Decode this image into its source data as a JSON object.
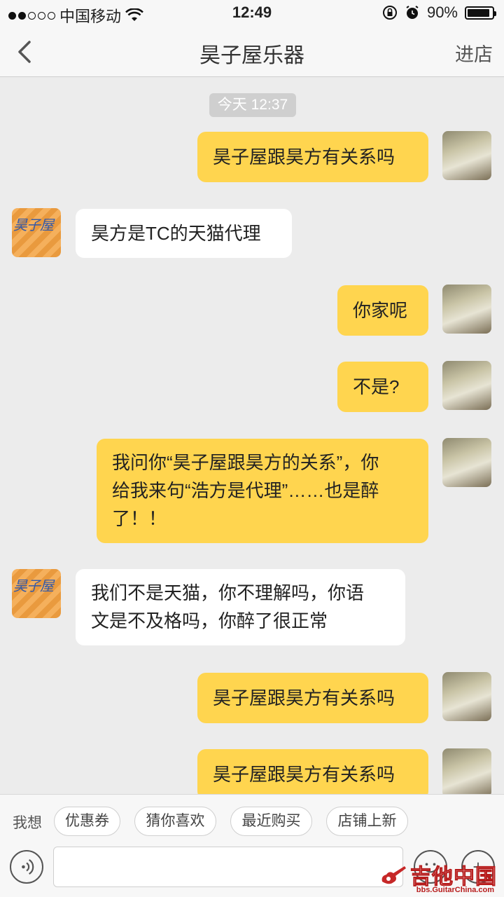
{
  "status_bar": {
    "carrier": "中国移动",
    "time": "12:49",
    "battery": "90%"
  },
  "nav": {
    "title": "昊子屋乐器",
    "right_label": "进店"
  },
  "chat": {
    "timestamp": "今天 12:37",
    "messages": [
      {
        "side": "mine",
        "text": "昊子屋跟昊方有关系吗"
      },
      {
        "side": "theirs",
        "text": "昊方是TC的天猫代理"
      },
      {
        "side": "mine",
        "text": "你家呢"
      },
      {
        "side": "mine",
        "text": "不是?"
      },
      {
        "side": "mine",
        "lines": [
          "我问你“昊子屋跟昊方的关系”，你",
          "给我来句“浩方是代理”……也是醉",
          "了！！"
        ]
      },
      {
        "side": "theirs",
        "lines": [
          "我们不是天猫，你不理解吗，你语",
          "文是不及格吗，你醉了很正常"
        ]
      },
      {
        "side": "mine",
        "text": "昊子屋跟昊方有关系吗"
      },
      {
        "side": "mine",
        "text": "昊子屋跟昊方有关系吗"
      }
    ],
    "shop_avatar_text": "昊子屋"
  },
  "bottom": {
    "want_label": "我想",
    "chips": [
      "优惠券",
      "猜你喜欢",
      "最近购买",
      "店铺上新"
    ],
    "add_symbol": "+",
    "watermark": "吉他中国",
    "watermark_url": "bbs.GuitarChina.com"
  }
}
